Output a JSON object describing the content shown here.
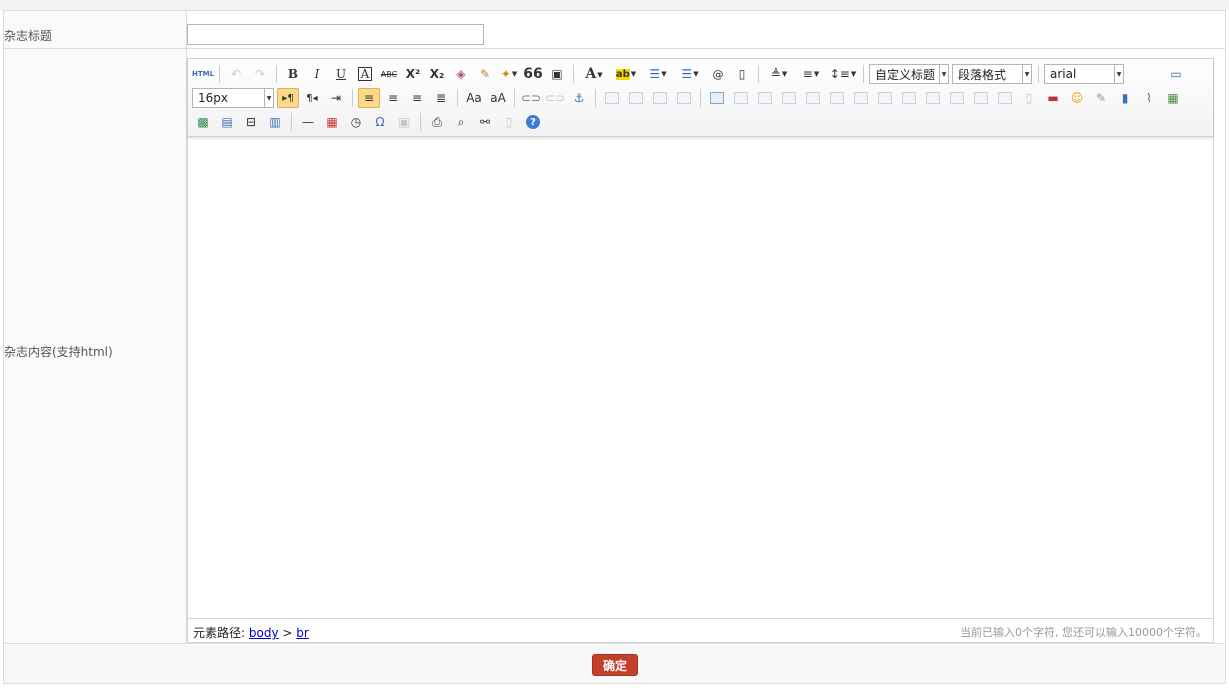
{
  "form": {
    "title_label": "杂志标题",
    "title_value": "",
    "content_label": "杂志内容(支持html)",
    "submit_label": "确定"
  },
  "editor": {
    "font_size": "16px",
    "heading_combo": "自定义标题",
    "paragraph_combo": "段落格式",
    "font_family": "arial",
    "path_label": "元素路径:",
    "path_body": "body",
    "path_sep": ">",
    "path_br": "br",
    "word_count": "当前已输入0个字符, 您还可以输入10000个字符。",
    "toolbar_row1": [
      "source-icon",
      "undo-icon",
      "redo-icon",
      "bold-icon",
      "italic-icon",
      "underline-icon",
      "font-border-icon",
      "strikethrough-icon",
      "superscript-icon",
      "subscript-icon",
      "remove-format-icon",
      "format-match-icon",
      "auto-typeset-icon",
      "blockquote-icon",
      "paste-plain-icon",
      "font-color-icon",
      "background-color-icon",
      "ordered-list-icon",
      "unordered-list-icon",
      "select-all-icon",
      "clear-doc-icon",
      "row-spacing-top-icon",
      "row-spacing-bottom-icon",
      "line-height-icon",
      "fullscreen-icon"
    ],
    "toolbar_labels": {
      "source": "HTML",
      "bold": "B",
      "italic": "I",
      "underline": "U",
      "font_border": "A",
      "strike": "ABC",
      "sup": "X²",
      "sub": "X₂",
      "quote": "66",
      "font_color": "A",
      "bg_color": "ab",
      "ltr": "▸¶",
      "rtl": "¶◂",
      "omega": "Ω",
      "help": "?"
    }
  }
}
